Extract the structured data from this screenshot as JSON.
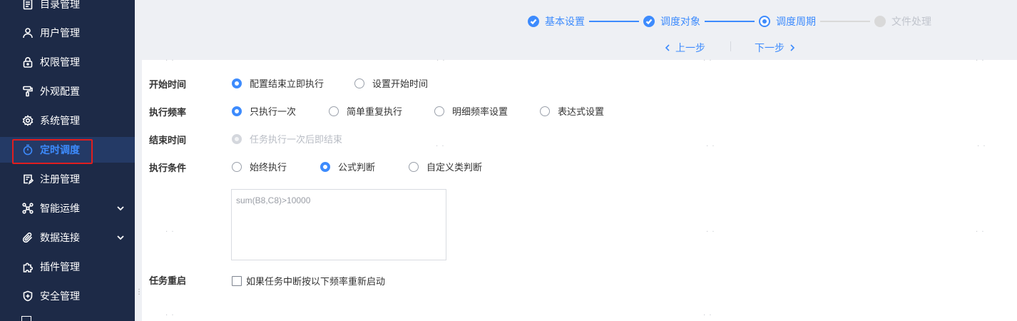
{
  "sidebar": {
    "items": [
      {
        "label": "目录管理",
        "icon": "catalog-icon"
      },
      {
        "label": "用户管理",
        "icon": "user-icon"
      },
      {
        "label": "权限管理",
        "icon": "lock-icon"
      },
      {
        "label": "外观配置",
        "icon": "paint-roller-icon"
      },
      {
        "label": "系统管理",
        "icon": "gear-icon"
      },
      {
        "label": "定时调度",
        "icon": "timer-icon"
      },
      {
        "label": "注册管理",
        "icon": "register-icon"
      },
      {
        "label": "智能运维",
        "icon": "network-icon"
      },
      {
        "label": "数据连接",
        "icon": "paperclip-icon"
      },
      {
        "label": "插件管理",
        "icon": "puzzle-icon"
      },
      {
        "label": "安全管理",
        "icon": "shield-icon"
      }
    ],
    "active_label": "定时调度",
    "active_color": "#3d8bfd",
    "background_color": "#1d2a47"
  },
  "steps": {
    "items": [
      {
        "label": "基本设置",
        "state": "done"
      },
      {
        "label": "调度对象",
        "state": "done"
      },
      {
        "label": "调度周期",
        "state": "current"
      },
      {
        "label": "文件处理",
        "state": "pending"
      }
    ],
    "prev_label": "上一步",
    "next_label": "下一步"
  },
  "form": {
    "start_time": {
      "label": "开始时间",
      "options": [
        {
          "label": "配置结束立即执行",
          "checked": true
        },
        {
          "label": "设置开始时间",
          "checked": false
        }
      ]
    },
    "frequency": {
      "label": "执行频率",
      "options": [
        {
          "label": "只执行一次",
          "checked": true
        },
        {
          "label": "简单重复执行",
          "checked": false
        },
        {
          "label": "明细频率设置",
          "checked": false
        },
        {
          "label": "表达式设置",
          "checked": false
        }
      ]
    },
    "end_time": {
      "label": "结束时间",
      "options": [
        {
          "label": "任务执行一次后即结束",
          "checked": true,
          "disabled": true
        }
      ]
    },
    "condition": {
      "label": "执行条件",
      "options": [
        {
          "label": "始终执行",
          "checked": false
        },
        {
          "label": "公式判断",
          "checked": true
        },
        {
          "label": "自定义类判断",
          "checked": false
        }
      ],
      "formula_value": "sum(B8,C8)>10000"
    },
    "restart": {
      "label": "任务重启",
      "checkbox_label": "如果任务中断按以下频率重新启动",
      "checked": false
    }
  }
}
